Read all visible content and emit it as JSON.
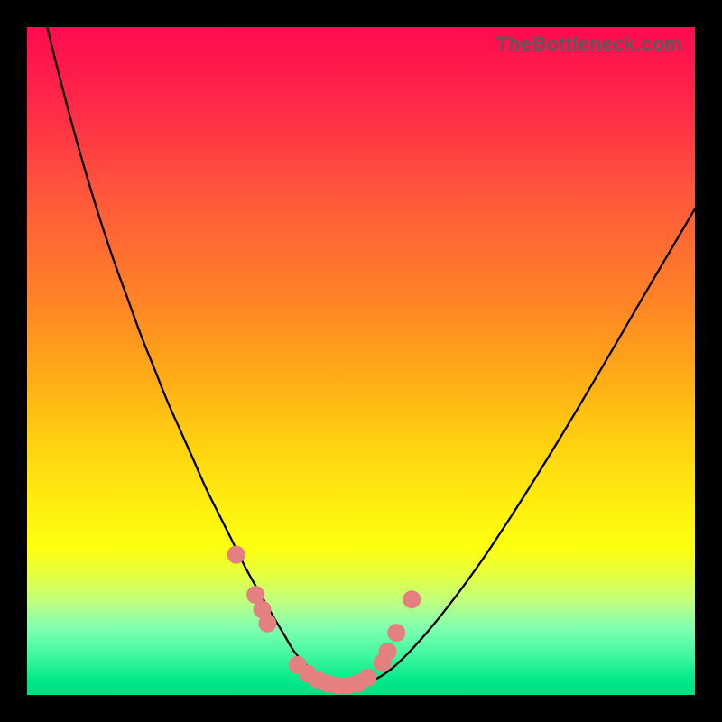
{
  "attribution": "TheBottleneck.com",
  "colors": {
    "black": "#000000",
    "curve_stroke": "#000000",
    "marker_fill": "#e58080",
    "gradient_top": "#ff0a50",
    "gradient_bottom": "#00e080"
  },
  "chart_data": {
    "type": "line",
    "title": "",
    "xlabel": "",
    "ylabel": "",
    "xlim": [
      0,
      100
    ],
    "ylim": [
      0,
      100
    ],
    "grid": false,
    "series": [
      {
        "name": "bottleneck-curve",
        "x": [
          3,
          5,
          7,
          9,
          11,
          13,
          15,
          17,
          19,
          21,
          23,
          25,
          27,
          29,
          31,
          33,
          35,
          37,
          38.5,
          40,
          42,
          44,
          46,
          48,
          50,
          53,
          56,
          60,
          64,
          68,
          72,
          76,
          80,
          84,
          88,
          92,
          96,
          100
        ],
        "y": [
          100,
          92,
          84.5,
          77.5,
          71,
          65,
          59.5,
          54,
          49,
          44,
          39.5,
          35,
          30.5,
          26.5,
          22.5,
          18.5,
          15,
          11.5,
          9,
          6.5,
          4.3,
          2.8,
          1.8,
          1.2,
          1.5,
          2.8,
          5.2,
          9.5,
          14.5,
          20,
          26,
          32.3,
          38.8,
          45.5,
          52.3,
          59.2,
          66,
          72.8
        ]
      }
    ],
    "markers": [
      {
        "x": 31.3,
        "y": 21.0
      },
      {
        "x": 34.2,
        "y": 15.0
      },
      {
        "x": 35.2,
        "y": 12.8
      },
      {
        "x": 36.0,
        "y": 10.7
      },
      {
        "x": 40.5,
        "y": 4.5
      },
      {
        "x": 42.0,
        "y": 3.2
      },
      {
        "x": 43.5,
        "y": 2.3
      },
      {
        "x": 45.0,
        "y": 1.7
      },
      {
        "x": 46.5,
        "y": 1.4
      },
      {
        "x": 48.0,
        "y": 1.4
      },
      {
        "x": 49.5,
        "y": 1.7
      },
      {
        "x": 51.0,
        "y": 2.6
      },
      {
        "x": 53.2,
        "y": 4.8
      },
      {
        "x": 54.0,
        "y": 6.5
      },
      {
        "x": 55.3,
        "y": 9.3
      },
      {
        "x": 57.6,
        "y": 14.3
      }
    ],
    "annotations": []
  }
}
